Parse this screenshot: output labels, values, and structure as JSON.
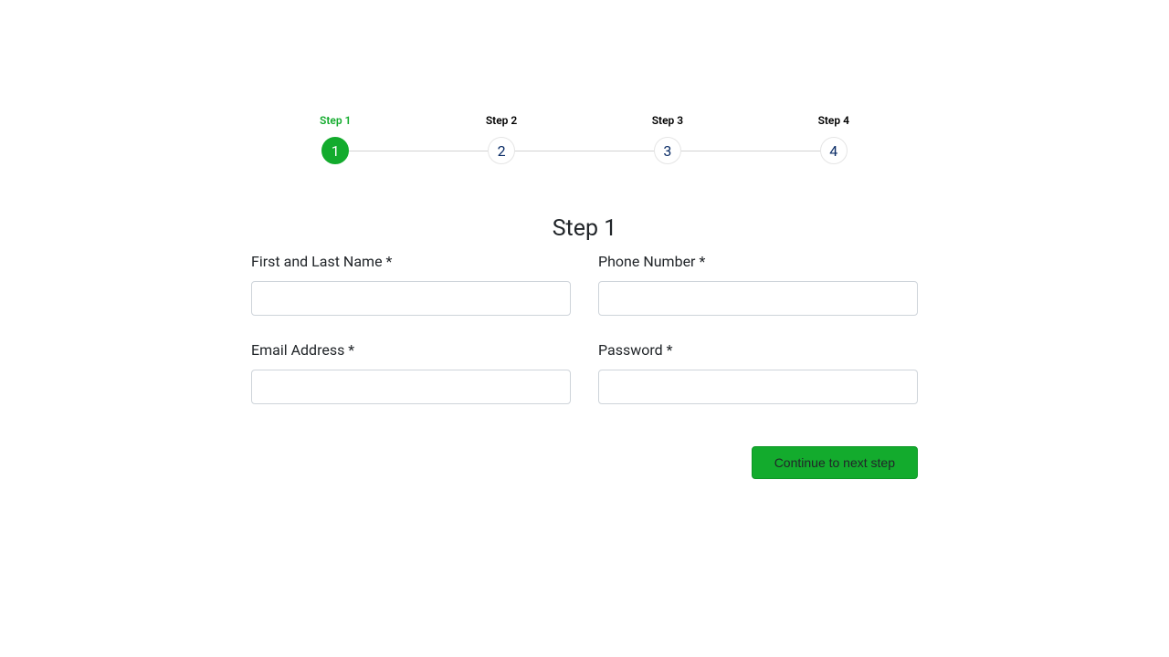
{
  "stepper": {
    "steps": [
      {
        "label": "Step 1",
        "number": "1",
        "active": true
      },
      {
        "label": "Step 2",
        "number": "2",
        "active": false
      },
      {
        "label": "Step 3",
        "number": "3",
        "active": false
      },
      {
        "label": "Step 4",
        "number": "4",
        "active": false
      }
    ]
  },
  "heading": "Step 1",
  "form": {
    "fields": [
      {
        "label": "First and Last Name *",
        "value": "",
        "type": "text"
      },
      {
        "label": "Phone Number *",
        "value": "",
        "type": "text"
      },
      {
        "label": "Email Address *",
        "value": "",
        "type": "email"
      },
      {
        "label": "Password *",
        "value": "",
        "type": "password"
      }
    ]
  },
  "actions": {
    "continue_label": "Continue to next step"
  }
}
